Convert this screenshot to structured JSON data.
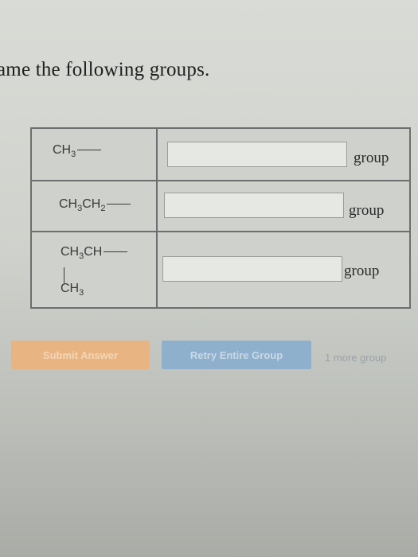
{
  "prompt": "ame the following groups.",
  "rows": [
    {
      "formula_main": "CH",
      "formula_sub": "3",
      "answer_value": "",
      "suffix": "group"
    },
    {
      "formula_a": "CH",
      "formula_a_sub": "3",
      "formula_b": "CH",
      "formula_b_sub": "2",
      "answer_value": "",
      "suffix": "group"
    },
    {
      "formula_top_a": "CH",
      "formula_top_a_sub": "3",
      "formula_top_b": "CH",
      "formula_branch": "CH",
      "formula_branch_sub": "3",
      "answer_value": "",
      "suffix": "group"
    }
  ],
  "buttons": {
    "submit": "Submit Answer",
    "retry": "Retry Entire Group"
  },
  "more_groups": "1 more group"
}
